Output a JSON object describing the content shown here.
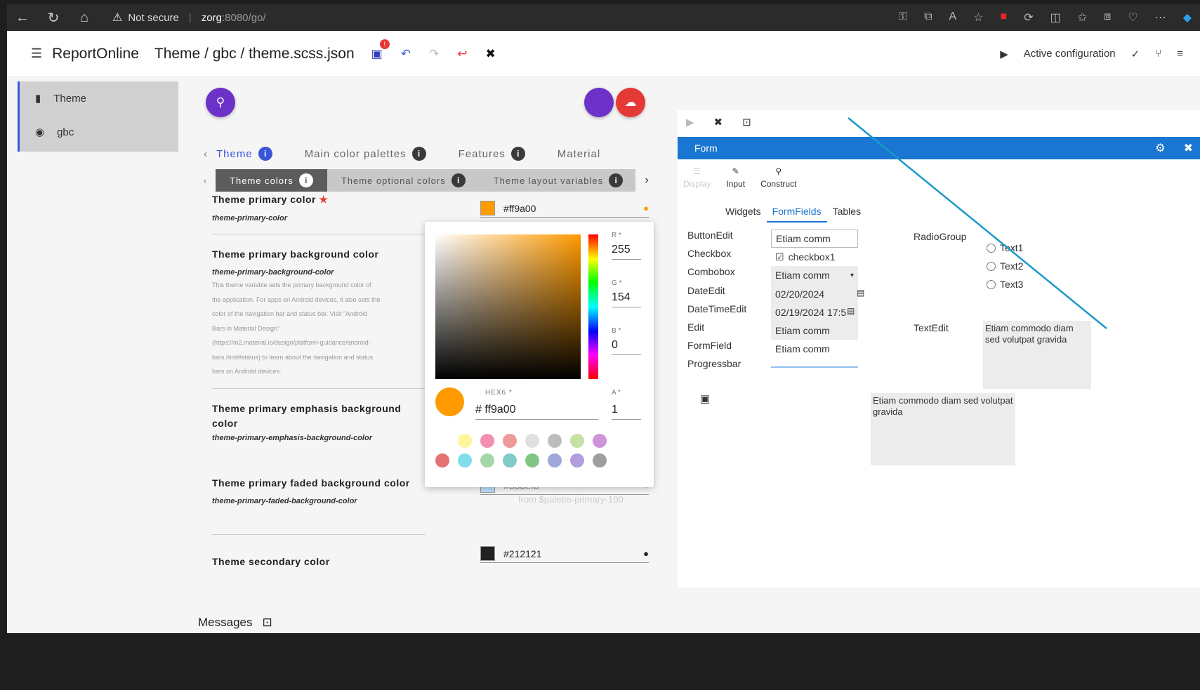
{
  "browser": {
    "not_secure": "Not secure",
    "url_host": "zorg",
    "url_rest": ":8080/go/"
  },
  "header": {
    "app_title": "ReportOnline",
    "breadcrumb": "Theme / gbc / theme.scss.json",
    "save_badge": "!",
    "active_configuration": "Active configuration"
  },
  "sidebar": {
    "items": [
      {
        "label": "Theme",
        "icon": "file-icon"
      },
      {
        "label": "gbc",
        "icon": "eye-icon"
      }
    ]
  },
  "tabs_primary": [
    {
      "label": "Theme"
    },
    {
      "label": "Main color palettes"
    },
    {
      "label": "Features"
    },
    {
      "label": "Material"
    }
  ],
  "tabs_secondary": [
    {
      "label": "Theme colors"
    },
    {
      "label": "Theme optional colors"
    },
    {
      "label": "Theme layout variables"
    }
  ],
  "variables": [
    {
      "title": "Theme primary color",
      "name": "theme-primary-color",
      "value": "#ff9a00",
      "swatch": "#ff9a00"
    },
    {
      "title": "Theme primary background color",
      "name": "theme-primary-background-color",
      "desc_lines": [
        "This theme variable sets the primary background color of",
        "the application. For apps on Android devices, it also sets the",
        "color of the navigation bar and status bar. Visit \"Android",
        "Bars in Material Design\"",
        "(https://m2.material.io/design/platform-guidance/android-",
        "bars.html#status) to learn about the navigation and status",
        "bars on Android devices."
      ]
    },
    {
      "title": "Theme primary emphasis background color",
      "name": "theme-primary-emphasis-background-color"
    },
    {
      "title": "Theme primary faded background color",
      "name": "theme-primary-faded-background-color",
      "value": "#bbdefb",
      "swatch": "#bbdefb",
      "from": "from $palette-primary-100"
    },
    {
      "title": "Theme secondary color",
      "value": "#212121",
      "swatch": "#212121"
    }
  ],
  "picker": {
    "r_label": "R *",
    "r": "255",
    "g_label": "G *",
    "g": "154",
    "b_label": "B *",
    "b": "0",
    "hex_label": "HEX6 *",
    "hex": "# ff9a00",
    "a_label": "A *",
    "a": "1",
    "preset_row1": [
      "#fff59d",
      "#f48fb1",
      "#ef9a9a",
      "#e0e0e0",
      "#bdbdbd",
      "#c5e1a5",
      "#ce93d8"
    ],
    "preset_row2": [
      "#e57373",
      "#80deea",
      "#a5d6a7",
      "#80cbc4",
      "#81c784",
      "#9fa8da",
      "#b39ddb",
      "#9e9e9e"
    ]
  },
  "messages_label": "Messages",
  "right_panel": {
    "form_title": "Form",
    "palette": [
      {
        "label": "Display",
        "icon": "list-icon"
      },
      {
        "label": "Input",
        "icon": "edit-icon"
      },
      {
        "label": "Construct",
        "icon": "search-icon"
      }
    ],
    "subtabs": [
      "Widgets",
      "FormFields",
      "Tables"
    ],
    "widget_labels": [
      "ButtonEdit",
      "Checkbox",
      "Combobox",
      "DateEdit",
      "DateTimeEdit",
      "Edit",
      "FormField",
      "Progressbar"
    ],
    "buttonedit_value": "Etiam comm",
    "checkbox_value": "checkbox1",
    "combobox_value": "Etiam comm",
    "dateedit_value": "02/20/2024",
    "datetimeedit_value": "02/19/2024 17:5",
    "edit_value": "Etiam comm",
    "formfield_value": "Etiam comm",
    "radiogroup_label": "RadioGroup",
    "radio_options": [
      "Text1",
      "Text2",
      "Text3"
    ],
    "textedit_label": "TextEdit",
    "textedit_value": "Etiam commodo diam sed volutpat gravida",
    "textarea_value": "Etiam commodo diam sed volutpat gravida"
  }
}
